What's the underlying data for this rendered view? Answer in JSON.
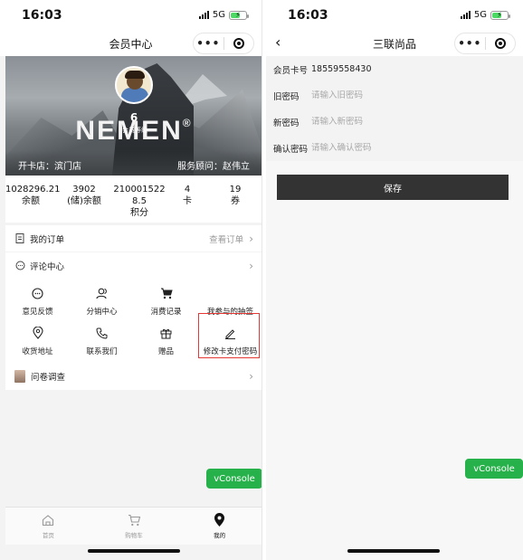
{
  "colors": {
    "accent_green": "#26b14a",
    "highlight_red": "#e53935",
    "dark_button": "#333333"
  },
  "left": {
    "status": {
      "time": "16:03",
      "network": "5G"
    },
    "navbar": {
      "title": "会员中心"
    },
    "hero": {
      "brand": "NEMEN",
      "brand_mark": "®",
      "level": "6",
      "level_sub": "会员等级",
      "store": "开卡店：滨门店",
      "advisor": "服务顾问：赵伟立"
    },
    "stats": [
      {
        "value": "1028296.21",
        "label": "余额"
      },
      {
        "value": "3902",
        "label": "(储)余额"
      },
      {
        "value": "2100015228.5",
        "label": "积分"
      },
      {
        "value": "4",
        "label": "卡"
      },
      {
        "value": "19",
        "label": "券"
      }
    ],
    "orders": {
      "label": "我的订单",
      "more": "查看订单"
    },
    "comments": {
      "label": "评论中心"
    },
    "grid": [
      {
        "label": "意见反馈",
        "icon": "chat-icon"
      },
      {
        "label": "分销中心",
        "icon": "users-icon"
      },
      {
        "label": "消费记录",
        "icon": "cart-icon"
      },
      {
        "label": "我参与的抽签",
        "icon": ""
      },
      {
        "label": "收货地址",
        "icon": "location-icon"
      },
      {
        "label": "联系我们",
        "icon": "phone-icon"
      },
      {
        "label": "赠品",
        "icon": "gift-icon"
      },
      {
        "label": "修改卡支付密码",
        "icon": "edit-icon"
      }
    ],
    "survey": {
      "label": "问卷调查"
    },
    "vconsole": "vConsole",
    "tabs": [
      {
        "label": "首页",
        "icon": "home-icon"
      },
      {
        "label": "购物车",
        "icon": "cart-icon"
      },
      {
        "label": "我的",
        "icon": "location-pin-icon"
      }
    ]
  },
  "right": {
    "status": {
      "time": "16:03",
      "network": "5G"
    },
    "navbar": {
      "title": "三联尚品"
    },
    "card": {
      "label": "会员卡号",
      "value": "18559558430"
    },
    "old_password": {
      "label": "旧密码",
      "placeholder": "请输入旧密码"
    },
    "new_password": {
      "label": "新密码",
      "placeholder": "请输入新密码"
    },
    "confirm_password": {
      "label": "确认密码",
      "placeholder": "请输入确认密码"
    },
    "save_label": "保存",
    "vconsole": "vConsole"
  }
}
